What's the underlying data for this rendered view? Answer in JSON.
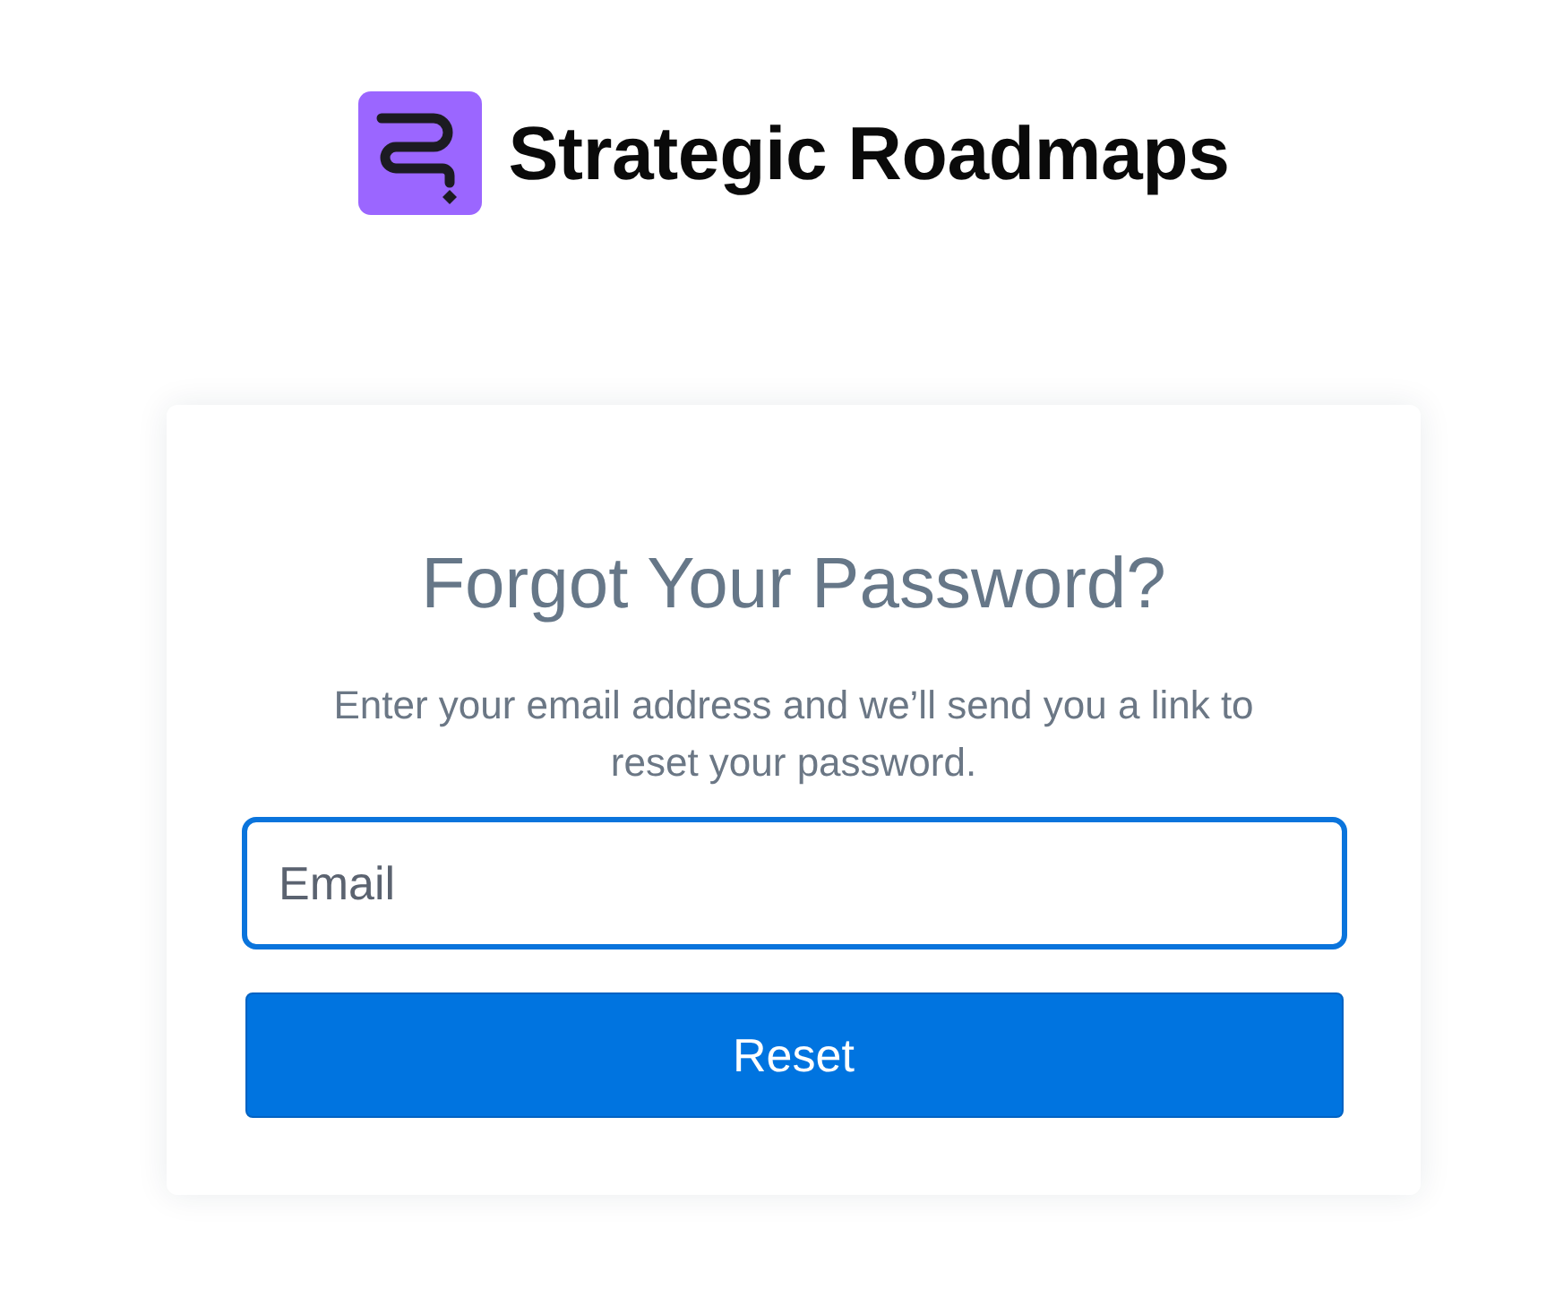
{
  "brand": {
    "name": "Strategic Roadmaps"
  },
  "card": {
    "title": "Forgot Your Password?",
    "description": "Enter your email address and we’ll send you a link to reset your password.",
    "email_field": {
      "placeholder": "Email",
      "focused": true
    },
    "submit_button": {
      "label": "Reset"
    }
  }
}
